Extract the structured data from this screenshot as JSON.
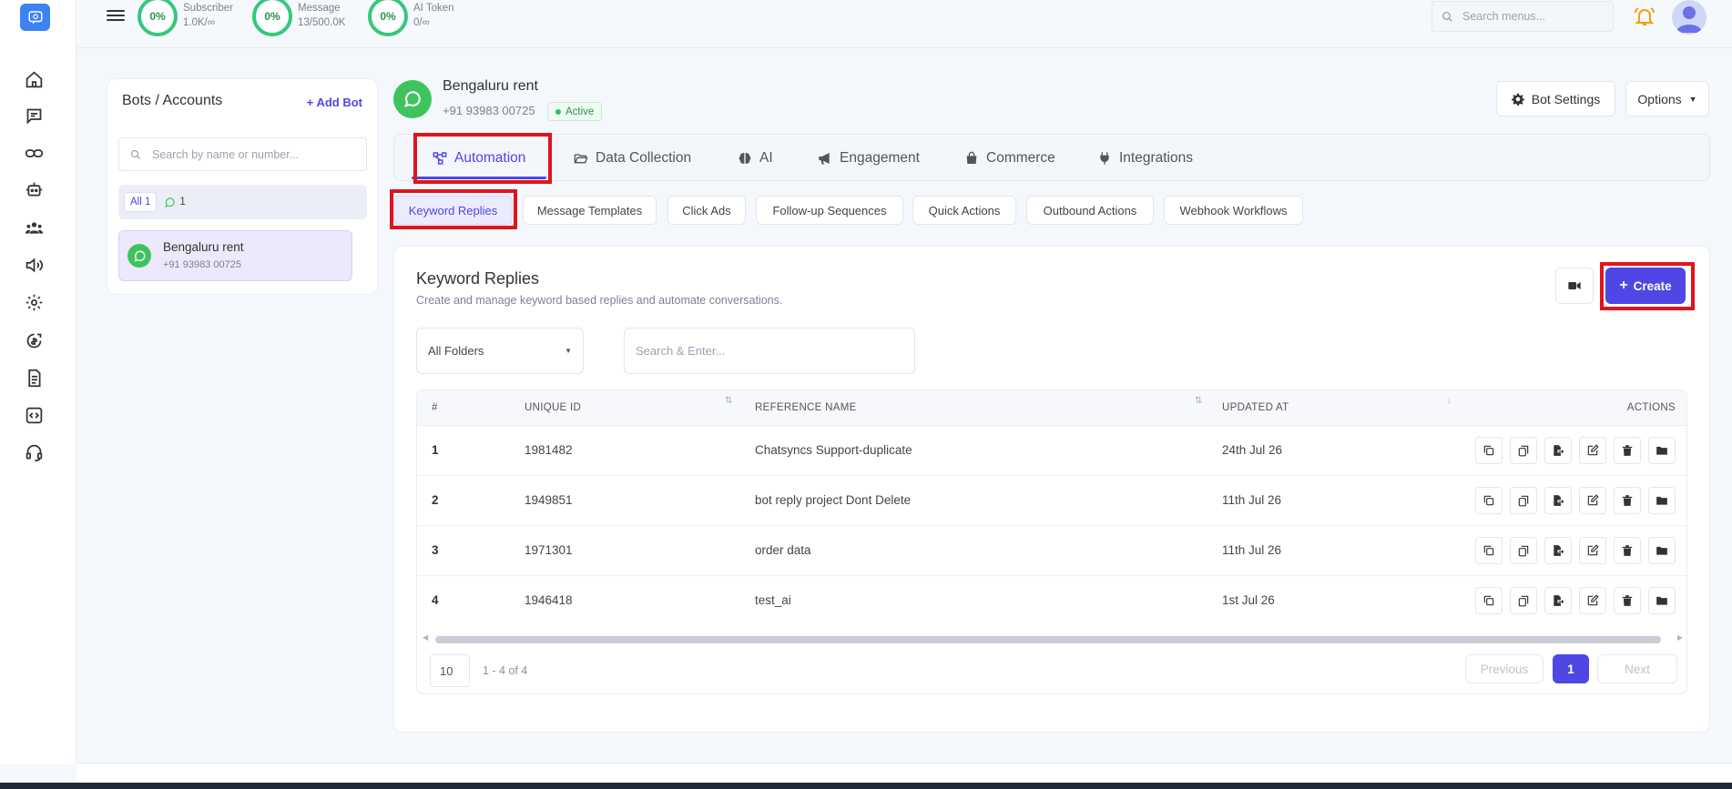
{
  "header": {
    "stats": [
      {
        "percent": "0%",
        "label": "Subscriber",
        "value": "1.0K/∞"
      },
      {
        "percent": "0%",
        "label": "Message",
        "value": "13/500.0K"
      },
      {
        "percent": "0%",
        "label": "AI Token",
        "value": "0/∞"
      }
    ],
    "search_placeholder": "Search menus..."
  },
  "bots_panel": {
    "title": "Bots / Accounts",
    "add_bot": "+ Add Bot",
    "search_placeholder": "Search by name or number...",
    "filter_all": "All 1",
    "filter_whatsapp_count": "1",
    "bots": [
      {
        "name": "Bengaluru rent",
        "phone": "+91 93983 00725"
      }
    ]
  },
  "bot_header": {
    "name": "Bengaluru rent",
    "phone": "+91 93983 00725",
    "status": "Active",
    "bot_settings": "Bot Settings",
    "options": "Options"
  },
  "tabs": [
    "Automation",
    "Data Collection",
    "AI",
    "Engagement",
    "Commerce",
    "Integrations"
  ],
  "subtabs": [
    "Keyword Replies",
    "Message Templates",
    "Click Ads",
    "Follow-up Sequences",
    "Quick Actions",
    "Outbound Actions",
    "Webhook Workflows"
  ],
  "card": {
    "title": "Keyword Replies",
    "subtitle": "Create and manage keyword based replies and automate conversations.",
    "create": "Create",
    "folder_select": "All Folders",
    "search_placeholder": "Search & Enter..."
  },
  "table": {
    "columns": [
      "#",
      "UNIQUE ID",
      "REFERENCE NAME",
      "UPDATED AT",
      "ACTIONS"
    ],
    "rows": [
      {
        "num": "1",
        "id": "1981482",
        "name": "Chatsyncs Support-duplicate",
        "updated": "24th Jul 26"
      },
      {
        "num": "2",
        "id": "1949851",
        "name": "bot reply project Dont Delete",
        "updated": "11th Jul 26"
      },
      {
        "num": "3",
        "id": "1971301",
        "name": "order data",
        "updated": "11th Jul 26"
      },
      {
        "num": "4",
        "id": "1946418",
        "name": "test_ai",
        "updated": "1st Jul 26"
      }
    ]
  },
  "pagination": {
    "page_size": "10",
    "info": "1 - 4 of 4",
    "previous": "Previous",
    "current": "1",
    "next": "Next"
  },
  "colors": {
    "accent": "#4f46e5",
    "whatsapp": "#3fc45d",
    "highlight": "#e0141c"
  }
}
